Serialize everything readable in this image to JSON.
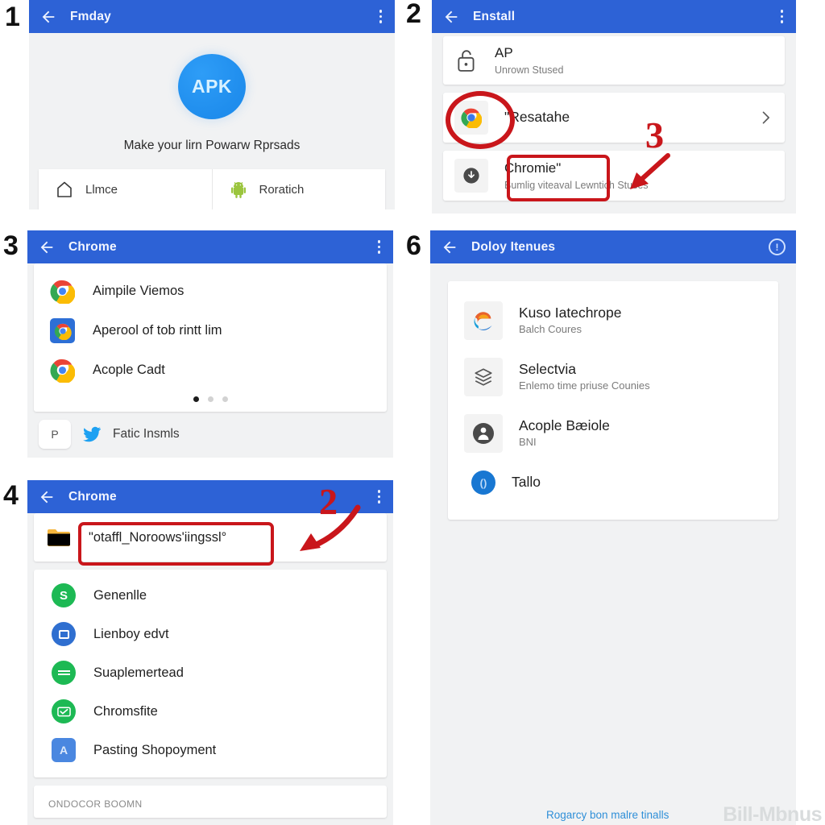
{
  "panels": {
    "p1": {
      "number": "1",
      "appbar": {
        "title": "Fmday",
        "back_icon": "back-arrow-icon",
        "menu_icon": "kebab-menu-icon"
      },
      "logo": {
        "label": "APK",
        "icon": "apk-circle-logo"
      },
      "tagline": "Make your lirn Powarw Rprsads",
      "buttons": [
        {
          "label": "Llmce",
          "icon": "home-outline-icon"
        },
        {
          "label": "Roratich",
          "icon": "android-robot-icon"
        }
      ]
    },
    "p2": {
      "number": "2",
      "appbar": {
        "title": "Enstall",
        "back_icon": "back-arrow-icon",
        "menu_icon": "kebab-menu-icon"
      },
      "rows": [
        {
          "title": "AP",
          "subtitle": "Unrown Stused",
          "icon": "padlock-outline-icon"
        },
        {
          "title": "\"Resatahe",
          "subtitle": "",
          "icon": "chrome-logo-icon",
          "chevron": "chevron-right-icon"
        },
        {
          "title": "Chromie\"",
          "subtitle": "Bumlig viteaval Lewntich Stuses",
          "icon": "download-circle-icon"
        }
      ],
      "annotation": {
        "number": "3",
        "arrow": "red-arrow-icon",
        "circle": "red-oval-highlight",
        "box": "red-box-highlight"
      }
    },
    "p3": {
      "number": "3",
      "appbar": {
        "title": "Chrome",
        "back_icon": "back-arrow-icon",
        "menu_icon": "kebab-menu-icon"
      },
      "rows": [
        {
          "label": "Aimpile Viemos",
          "icon": "chrome-logo-icon"
        },
        {
          "label": "Aperool of tob rintt lim",
          "icon": "chrome-square-blue-icon"
        },
        {
          "label": "Acople Cadt",
          "icon": "chrome-logo-icon"
        }
      ],
      "dots": {
        "count": 3,
        "active_index": 0
      },
      "footer": {
        "badge": "P",
        "icon": "twitter-bird-icon",
        "label": "Fatic Insmls"
      }
    },
    "p4": {
      "number": "4",
      "appbar": {
        "title": "Chrome",
        "back_icon": "back-arrow-icon",
        "menu_icon": "kebab-menu-icon"
      },
      "folder_row": {
        "label": "\"otaffl_Noroows'iingssl°",
        "icon": "folder-icon"
      },
      "rows": [
        {
          "label": "Genenlle",
          "icon": "green-s-circle-icon"
        },
        {
          "label": "Lienboy edvt",
          "icon": "blue-square-circle-icon"
        },
        {
          "label": "Suaplemertead",
          "icon": "green-lines-circle-icon"
        },
        {
          "label": "Chromsfite",
          "icon": "green-check-circle-icon"
        },
        {
          "label": "Pasting Shopoyment",
          "icon": "blue-a-square-icon"
        }
      ],
      "bottom_cut_text": "ONDOCOR BOOMN",
      "annotation": {
        "number": "2",
        "arrow": "red-arrow-icon",
        "box": "red-box-highlight"
      }
    },
    "p6": {
      "number": "6",
      "appbar": {
        "title": "Doloy Itenues",
        "back_icon": "back-arrow-icon",
        "info_icon": "info-circle-icon"
      },
      "rows": [
        {
          "title": "Kuso Iatechrope",
          "subtitle": "Balch Coures",
          "icon": "edge-logo-icon"
        },
        {
          "title": "Selectvia",
          "subtitle": "Enlemo time priuse Counies",
          "icon": "box-outline-icon"
        },
        {
          "title": "Acople Bæiole",
          "subtitle": "BNI",
          "icon": "dark-person-circle-icon"
        },
        {
          "title": "Tallo",
          "subtitle": "",
          "icon": "blue-circle-icon"
        }
      ],
      "footer_link": "Rogarcy bon malre tinalls"
    }
  },
  "watermark": "Bill-Mbnus",
  "colors": {
    "appbar_blue": "#2d62d6",
    "annotation_red": "#c9161b",
    "panel_bg": "#f1f2f3",
    "link_blue": "#2f8fd8",
    "watermark_gray": "#d9dcdd"
  }
}
